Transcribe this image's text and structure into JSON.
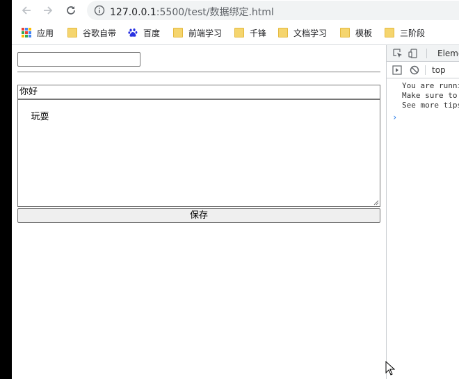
{
  "browser": {
    "url_host": "127.0.0.1",
    "url_rest": ":5500/test/数据绑定.html"
  },
  "bookmarks": [
    {
      "label": "应用",
      "icon": "apps-grid-icon"
    },
    {
      "label": "谷歌自带",
      "icon": "folder-icon"
    },
    {
      "label": "百度",
      "icon": "baidu-paw-icon"
    },
    {
      "label": "前端学习",
      "icon": "folder-icon"
    },
    {
      "label": "千锋",
      "icon": "folder-icon"
    },
    {
      "label": "文档学习",
      "icon": "folder-icon"
    },
    {
      "label": "模板",
      "icon": "folder-icon"
    },
    {
      "label": "三阶段",
      "icon": "folder-icon"
    }
  ],
  "page": {
    "top_input_value": "",
    "title_value": "你好",
    "content_value": "玩耍",
    "save_label": "保存"
  },
  "devtools": {
    "elements_tab": "Eleme",
    "context": "top",
    "console_lines": [
      "You are runni",
      "Make sure to ",
      "See more tips"
    ],
    "prompt": "›"
  },
  "colors": {
    "omnibox_bg": "#f1f3f4",
    "folder": "#f5d56e",
    "prompt": "#1a73e8"
  }
}
